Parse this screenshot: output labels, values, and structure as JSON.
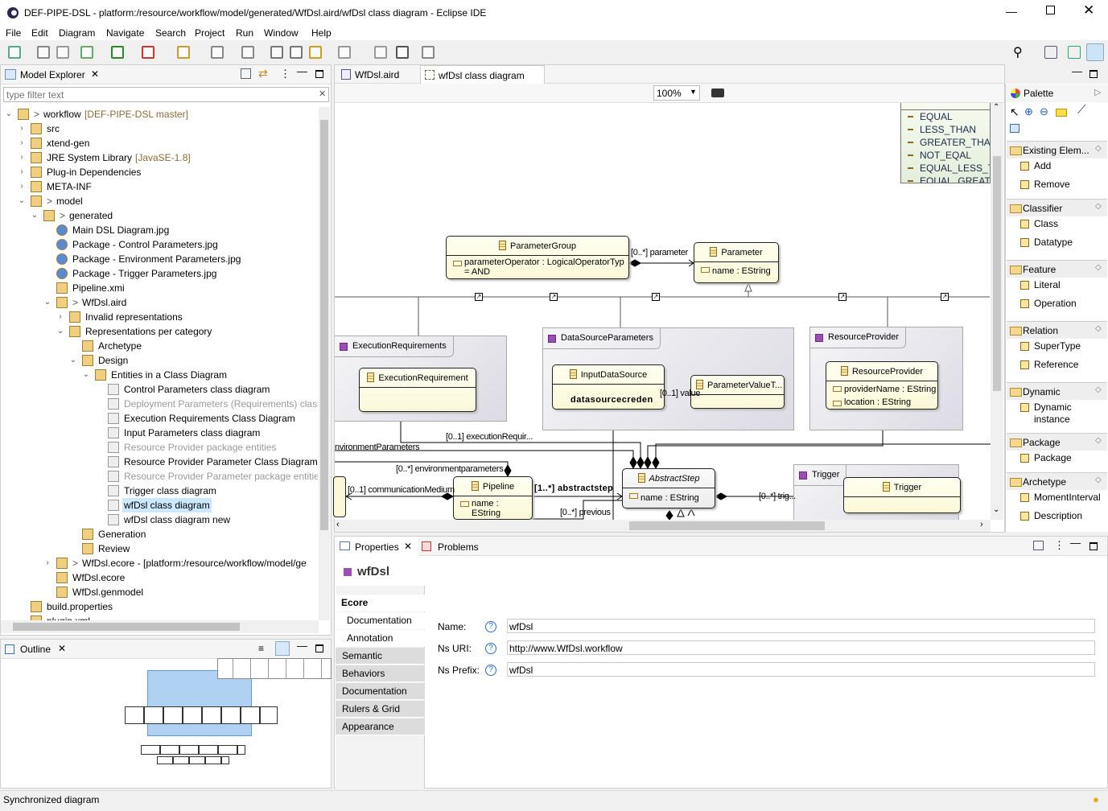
{
  "window": {
    "title": "DEF-PIPE-DSL - platform:/resource/workflow/model/generated/WfDsl.aird/wfDsl class diagram - Eclipse IDE"
  },
  "menu": [
    "File",
    "Edit",
    "Diagram",
    "Navigate",
    "Search",
    "Project",
    "Run",
    "Window",
    "Help"
  ],
  "model_explorer": {
    "title": "Model Explorer",
    "filter_placeholder": "type filter text",
    "items": [
      {
        "level": 0,
        "label": "workflow",
        "suffix": "[DEF-PIPE-DSL master]",
        "prefix": ">",
        "state": "open"
      },
      {
        "level": 1,
        "label": "src",
        "state": "closed"
      },
      {
        "level": 1,
        "label": "xtend-gen",
        "state": "closed"
      },
      {
        "level": 1,
        "label": "JRE System Library",
        "suffix": "[JavaSE-1.8]",
        "state": "closed"
      },
      {
        "level": 1,
        "label": "Plug-in Dependencies",
        "state": "closed"
      },
      {
        "level": 1,
        "label": "META-INF",
        "state": "closed"
      },
      {
        "level": 1,
        "label": "model",
        "prefix": ">",
        "state": "open"
      },
      {
        "level": 2,
        "label": "generated",
        "prefix": ">",
        "state": "open"
      },
      {
        "level": 3,
        "label": "Main DSL Diagram.jpg"
      },
      {
        "level": 3,
        "label": "Package - Control Parameters.jpg"
      },
      {
        "level": 3,
        "label": "Package - Environment Parameters.jpg"
      },
      {
        "level": 3,
        "label": "Package - Trigger Parameters.jpg"
      },
      {
        "level": 3,
        "label": "Pipeline.xmi"
      },
      {
        "level": 3,
        "label": "WfDsl.aird",
        "prefix": ">",
        "state": "open"
      },
      {
        "level": 4,
        "label": "Invalid representations",
        "state": "closed"
      },
      {
        "level": 4,
        "label": "Representations per category",
        "state": "open"
      },
      {
        "level": 5,
        "label": "Archetype"
      },
      {
        "level": 5,
        "label": "Design",
        "state": "open"
      },
      {
        "level": 6,
        "label": "Entities in a Class Diagram",
        "state": "open"
      },
      {
        "level": 7,
        "label": "Control Parameters class diagram"
      },
      {
        "level": 7,
        "label": "Deployment Parameters (Requirements) class",
        "grey": true
      },
      {
        "level": 7,
        "label": "Execution Requirements Class Diagram"
      },
      {
        "level": 7,
        "label": "Input Parameters class diagram"
      },
      {
        "level": 7,
        "label": "Resource Provider package entities",
        "grey": true
      },
      {
        "level": 7,
        "label": "Resource Provider Parameter Class Diagram"
      },
      {
        "level": 7,
        "label": "Resource Provider Parameter package entities",
        "grey": true
      },
      {
        "level": 7,
        "label": "Trigger class diagram"
      },
      {
        "level": 7,
        "label": "wfDsl class diagram",
        "selected": true
      },
      {
        "level": 7,
        "label": "wfDsl class diagram new"
      },
      {
        "level": 5,
        "label": "Generation"
      },
      {
        "level": 5,
        "label": "Review"
      },
      {
        "level": 3,
        "label": "WfDsl.ecore - [platform:/resource/workflow/model/ge",
        "prefix": ">",
        "state": "closed"
      },
      {
        "level": 3,
        "label": "WfDsl.ecore"
      },
      {
        "level": 3,
        "label": "WfDsl.genmodel"
      },
      {
        "level": 1,
        "label": "build.properties"
      },
      {
        "level": 1,
        "label": "plugin.xml"
      }
    ]
  },
  "outline": {
    "title": "Outline"
  },
  "editor": {
    "tabs": [
      {
        "label": "WfDsl.aird",
        "active": false
      },
      {
        "label": "wfDsl class diagram",
        "active": true
      }
    ],
    "zoom": "100%"
  },
  "diagram": {
    "enum_literals": [
      "EQUAL",
      "LESS_THAN",
      "GREATER_THAN",
      "NOT_EQAL",
      "EQUAL_LESS_TH",
      "EQUAL_GREATE"
    ],
    "classes": {
      "parameter_group": {
        "name": "ParameterGroup",
        "attrs": [
          "parameterOperator : LogicalOperatorTyp",
          "= AND"
        ]
      },
      "parameter": {
        "name": "Parameter",
        "attrs": [
          "name : EString"
        ]
      },
      "execution_requirement": {
        "name": "ExecutionRequirement"
      },
      "input_data_source": {
        "name": "InputDataSource",
        "attrs": [
          "datasourcecreden"
        ]
      },
      "parameter_value": {
        "name": "ParameterValueT..."
      },
      "resource_provider": {
        "name": "ResourceProvider",
        "attrs": [
          "providerName : EString",
          "location : EString"
        ]
      },
      "abstract_step": {
        "name": "AbstractStep",
        "attrs": [
          "name : EString"
        ]
      },
      "pipeline": {
        "name": "Pipeline",
        "attrs": [
          "name :",
          "EString"
        ]
      },
      "trigger": {
        "name": "Trigger"
      }
    },
    "packages": {
      "execution": "ExecutionRequirements",
      "datasource": "DataSourceParameters",
      "resource": "ResourceProvider",
      "trigger": "Trigger"
    },
    "labels": {
      "parameter": "[0..*] parameter",
      "value": "[0..1] value",
      "execution": "[0..1] executionRequir...",
      "env_params": "nvironmentParameters",
      "env_params2": "[0..*] environmentparameters",
      "comm": "[0..1] communicationMedium",
      "abstractstep": "[1..*] abstractstep",
      "previous": "[0..*] previous",
      "trig": "[0..*] trig..."
    }
  },
  "palette": {
    "title": "Palette",
    "drawers": [
      {
        "label": "Existing Elem...",
        "items": [
          "Add",
          "Remove"
        ]
      },
      {
        "label": "Classifier",
        "items": [
          "Class",
          "Datatype"
        ]
      },
      {
        "label": "Feature",
        "items": [
          "Literal",
          "Operation"
        ]
      },
      {
        "label": "Relation",
        "items": [
          "SuperType",
          "Reference"
        ]
      },
      {
        "label": "Dynamic",
        "items": [
          "Dynamic instance"
        ]
      },
      {
        "label": "Package",
        "items": [
          "Package"
        ]
      },
      {
        "label": "Archetype",
        "items": [
          "MomentInterval",
          "Description"
        ]
      }
    ]
  },
  "properties": {
    "tabs": [
      "Properties",
      "Problems"
    ],
    "title": "wfDsl",
    "sections": [
      "Ecore",
      "Documentation",
      "Annotation",
      "Semantic",
      "Behaviors",
      "Documentation",
      "Rulers & Grid",
      "Appearance"
    ],
    "fields": [
      {
        "label": "Name:",
        "value": "wfDsl"
      },
      {
        "label": "Ns URI:",
        "value": "http://www.WfDsl.workflow"
      },
      {
        "label": "Ns Prefix:",
        "value": "wfDsl"
      }
    ]
  },
  "status": {
    "text": "Synchronized diagram"
  },
  "colors": {
    "selection": "#cce8ff",
    "class_fill": "#fbf8d8",
    "package_icon": "#9b4fb5",
    "enum_fill": "#eef5e6",
    "outline_viewport": "#9cc8f0"
  }
}
